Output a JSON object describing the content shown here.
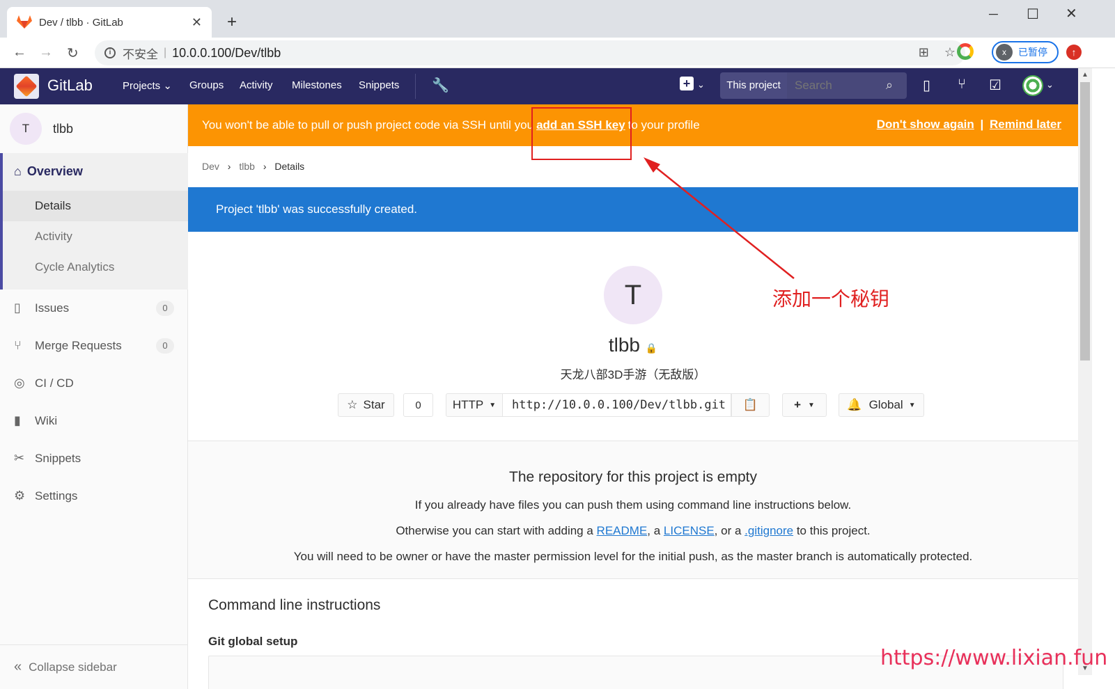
{
  "browser": {
    "tab_title": "Dev / tlbb · GitLab",
    "tab_close": "✕",
    "new_tab": "+",
    "security": "不安全",
    "url": "10.0.0.100/Dev/tlbb",
    "profile_initial": "x",
    "profile_status": "已暂停",
    "update_badge": "↑"
  },
  "header": {
    "brand": "GitLab",
    "nav": [
      "Projects",
      "Groups",
      "Activity",
      "Milestones",
      "Snippets"
    ],
    "search_scope": "This project",
    "search_placeholder": "Search"
  },
  "sidebar": {
    "project_initial": "T",
    "project_name": "tlbb",
    "overview": "Overview",
    "overview_sub": [
      "Details",
      "Activity",
      "Cycle Analytics"
    ],
    "items": [
      {
        "label": "Issues",
        "count": "0",
        "icon": "issues-icon"
      },
      {
        "label": "Merge Requests",
        "count": "0",
        "icon": "merge-request-icon"
      },
      {
        "label": "CI / CD",
        "icon": "rocket-icon"
      },
      {
        "label": "Wiki",
        "icon": "book-icon"
      },
      {
        "label": "Snippets",
        "icon": "scissors-icon"
      },
      {
        "label": "Settings",
        "icon": "gear-icon"
      }
    ],
    "collapse": "Collapse sidebar"
  },
  "alert": {
    "text_before": "You won't be able to pull or push project code via SSH until you",
    "link": "add an SSH key",
    "text_after": "to your profile",
    "dont_show": "Don't show again",
    "separator": "|",
    "remind": "Remind later"
  },
  "breadcrumb": [
    "Dev",
    "tlbb",
    "Details"
  ],
  "flash": "Project 'tlbb' was successfully created.",
  "project": {
    "initial": "T",
    "title": "tlbb",
    "description": "天龙八部3D手游（无敌版）",
    "star_label": "Star",
    "star_count": "0",
    "protocol": "HTTP",
    "clone_url": "http://10.0.0.100/Dev/tlbb.git",
    "notification": "Global"
  },
  "empty": {
    "title": "The repository for this project is empty",
    "line1": "If you already have files you can push them using command line instructions below.",
    "line2_before": "Otherwise you can start with adding a",
    "readme": "README",
    "comma1": ", a",
    "license": "LICENSE",
    "comma2": ", or a",
    "gitignore": ".gitignore",
    "line2_after": "to this project.",
    "line3": "You will need to be owner or have the master permission level for the initial push, as the master branch is automatically protected."
  },
  "cli": {
    "title": "Command line instructions",
    "global_setup": "Git global setup"
  },
  "annotation": {
    "note": "添加一个秘钥",
    "watermark": "https://www.lixian.fun",
    "color": "#e02020"
  }
}
